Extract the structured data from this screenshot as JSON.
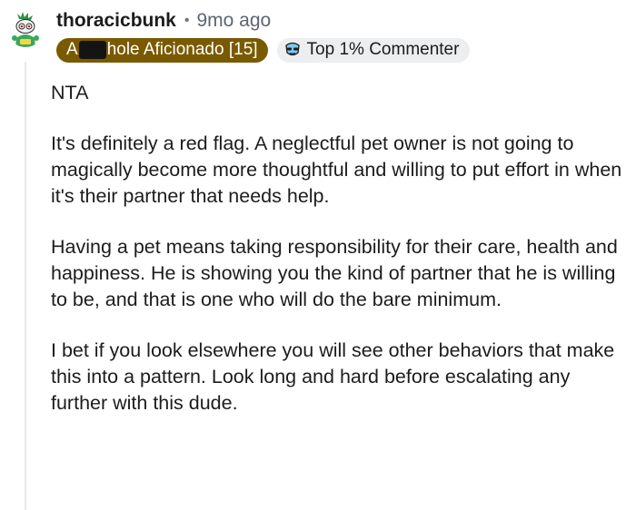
{
  "comment": {
    "username": "thoracicbunk",
    "separator": "•",
    "timestamp": "9mo ago",
    "flair": {
      "prefix": "A",
      "suffix": "hole Aficionado [15]",
      "color": "#7a5a00"
    },
    "badge": {
      "icon": "commenter-badge-icon",
      "label": "Top 1% Commenter"
    },
    "paragraphs": [
      "NTA",
      "It's definitely a red flag. A neglectful pet owner is not going to magically become more thoughtful and willing to put effort in when it's their partner that needs help.",
      "Having a pet means taking responsibility for their care, health and happiness. He is showing you the kind of partner that he is willing to be, and that is one who will do the bare minimum.",
      "I bet if you look elsewhere you will see other behaviors that make this into a pattern. Look long and hard before escalating any further with this dude."
    ]
  }
}
